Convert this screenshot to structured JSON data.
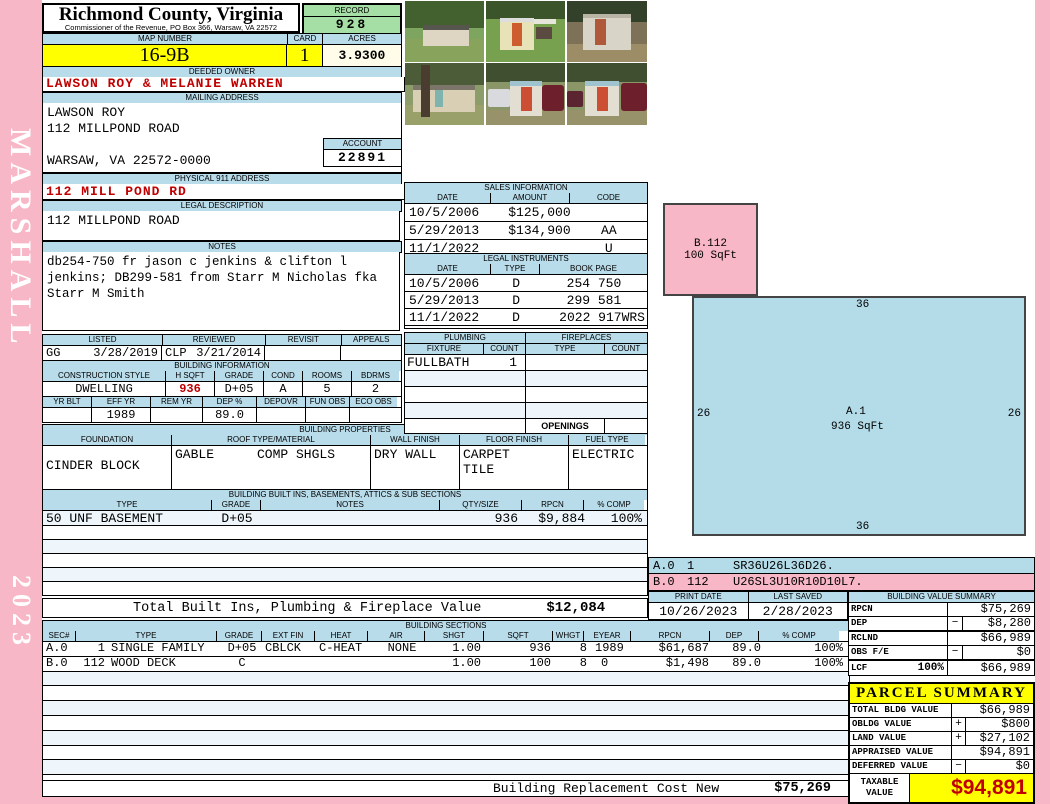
{
  "county": {
    "title": "Richmond County, Virginia",
    "subtitle": "Commissioner of the Revenue, PO Box 366, Warsaw, VA 22572"
  },
  "record": {
    "label": "RECORD",
    "value": "928"
  },
  "map": {
    "label": "MAP NUMBER",
    "value": "16-9B"
  },
  "card": {
    "label": "CARD",
    "value": "1"
  },
  "acres": {
    "label": "ACRES",
    "value": "3.9300"
  },
  "deeded_owner": {
    "label": "DEEDED OWNER",
    "value": "LAWSON ROY & MELANIE WARREN"
  },
  "mailing": {
    "label": "MAILING ADDRESS",
    "line1": "LAWSON ROY",
    "line2": "112 MILLPOND ROAD",
    "line3": "WARSAW, VA 22572-0000"
  },
  "account": {
    "label": "ACCOUNT",
    "value": "22891"
  },
  "physical_address": {
    "label": "PHYSICAL 911 ADDRESS",
    "value": "112 MILL POND RD"
  },
  "legal_description": {
    "label": "LEGAL DESCRIPTION",
    "value": "112 MILLPOND ROAD"
  },
  "notes": {
    "label": "NOTES",
    "text": "db254-750 fr jason c jenkins & clifton l jenkins; DB299-581 from Starr M Nicholas fka Starr M Smith"
  },
  "review": {
    "headers": {
      "listed": "LISTED",
      "reviewed": "REVIEWED",
      "revisit": "REVISIT",
      "appeals": "APPEALS"
    },
    "listed_by": "GG",
    "listed_date": "3/28/2019",
    "reviewed_by": "CLP",
    "reviewed_date": "3/21/2014",
    "revisit": "",
    "appeals": ""
  },
  "building_information": {
    "label": "BUILDING INFORMATION",
    "h1": {
      "style": "CONSTRUCTION STYLE",
      "hsqft": "H SQFT",
      "grade": "GRADE",
      "cond": "COND",
      "rooms": "ROOMS",
      "bdrms": "BDRMS"
    },
    "style": "DWELLING",
    "hsqft": "936",
    "grade": "D+05",
    "cond": "A",
    "rooms": "5",
    "bdrms": "2",
    "h2": {
      "yrblt": "YR BLT",
      "effyr": "EFF YR",
      "remyr": "REM YR",
      "dep": "DEP %",
      "depovr": "DEPOVR",
      "funobs": "FUN OBS",
      "ecoobs": "ECO OBS"
    },
    "yr_blt": "",
    "eff_yr": "1989",
    "rem_yr": "",
    "dep_pct": "89.0",
    "depovr": "",
    "fun_obs": "",
    "eco_obs": ""
  },
  "building_properties": {
    "label": "BUILDING PROPERTIES",
    "h": {
      "foundation": "FOUNDATION",
      "roof": "ROOF TYPE/MATERIAL",
      "wall": "WALL FINISH",
      "floor": "FLOOR FINISH",
      "fuel": "FUEL TYPE"
    },
    "foundation": "CINDER BLOCK",
    "roof_type": "GABLE",
    "roof_material": "COMP SHGLS",
    "wall_finish": "DRY WALL",
    "floor_finish_1": "CARPET",
    "floor_finish_2": "TILE",
    "fuel_type": "ELECTRIC"
  },
  "built_ins": {
    "label": "BUILDING BUILT INS, BASEMENTS, ATTICS & SUB SECTIONS",
    "h": {
      "type": "TYPE",
      "grade": "GRADE",
      "notes": "NOTES",
      "qty": "QTY/SIZE",
      "rpcn": "RPCN",
      "comp": "% COMP"
    },
    "rows": [
      {
        "type": "50 UNF BASEMENT",
        "grade": "D+05",
        "notes": "",
        "qty": "936",
        "rpcn": "$9,884",
        "comp": "100%"
      }
    ],
    "total_label": "Total Built Ins, Plumbing & Fireplace Value",
    "total_value": "$12,084"
  },
  "sales": {
    "label": "SALES INFORMATION",
    "h": {
      "date": "DATE",
      "amount": "AMOUNT",
      "code": "CODE"
    },
    "rows": [
      {
        "date": "10/5/2006",
        "amount": "$125,000",
        "code": ""
      },
      {
        "date": "5/29/2013",
        "amount": "$134,900",
        "code": "AA"
      },
      {
        "date": "11/1/2022",
        "amount": "",
        "code": "U"
      }
    ]
  },
  "legal_instruments": {
    "label": "LEGAL INSTRUMENTS",
    "h": {
      "date": "DATE",
      "type": "TYPE",
      "book": "BOOK PAGE"
    },
    "rows": [
      {
        "date": "10/5/2006",
        "type": "D",
        "book": "254 750"
      },
      {
        "date": "5/29/2013",
        "type": "D",
        "book": "299 581"
      },
      {
        "date": "11/1/2022",
        "type": "D",
        "book": "2022 917WRS"
      }
    ]
  },
  "plumbing": {
    "label": "PLUMBING",
    "h": {
      "fixture": "FIXTURE",
      "count": "COUNT"
    },
    "rows": [
      {
        "fixture": "FULLBATH",
        "count": "1"
      }
    ]
  },
  "fireplaces": {
    "label": "FIREPLACES",
    "h": {
      "type": "TYPE",
      "count": "COUNT"
    },
    "openings_label": "OPENINGS",
    "openings_value": ""
  },
  "sketch": {
    "b_box": {
      "line1": "B.112",
      "line2": "100 SqFt"
    },
    "a_box": {
      "line1": "A.1",
      "line2": "936 SqFt",
      "top": "36",
      "left": "26",
      "right": "26",
      "bottom": "36"
    },
    "legend": [
      {
        "sec": "A.0",
        "num": "1",
        "path": "SR36U26L36D26."
      },
      {
        "sec": "B.0",
        "num": "112",
        "path": "U26SL3U10R10D10L7."
      }
    ]
  },
  "print_info": {
    "print_label": "PRINT DATE",
    "print_date": "10/26/2023",
    "saved_label": "LAST SAVED",
    "saved_date": "2/28/2023"
  },
  "building_value_summary": {
    "label": "BUILDING VALUE SUMMARY",
    "rows": [
      {
        "name": "RPCN",
        "pct": "",
        "op": "",
        "value": "$75,269"
      },
      {
        "name": "DEP",
        "pct": "",
        "op": "−",
        "value": "$8,280"
      },
      {
        "name": "RCLND",
        "pct": "",
        "op": "",
        "value": "$66,989"
      },
      {
        "name": "OBS F/E",
        "pct": "",
        "op": "−",
        "value": "$0"
      },
      {
        "name": "LCF",
        "pct": "100%",
        "op": "",
        "value": "$66,989"
      }
    ]
  },
  "building_sections": {
    "label": "BUILDING SECTIONS",
    "h": {
      "sec": "SEC#",
      "type": "TYPE",
      "grade": "GRADE",
      "ext": "EXT FIN",
      "heat": "HEAT",
      "air": "AIR",
      "shgt": "SHGT",
      "sqft": "SQFT",
      "whgt": "WHGT",
      "eyear": "EYEAR",
      "rpcn": "RPCN",
      "dep": "DEP",
      "comp": "% COMP"
    },
    "rows": [
      {
        "sec": "A.0",
        "num": "1",
        "type": "SINGLE FAMILY",
        "grade": "D+05",
        "ext": "CBLCK",
        "heat": "C-HEAT",
        "air": "NONE",
        "shgt": "1.00",
        "sqft": "936",
        "whgt": "8",
        "eyear": "1989",
        "rpcn": "$61,687",
        "dep": "89.0",
        "comp": "100%"
      },
      {
        "sec": "B.0",
        "num": "112",
        "type": "WOOD DECK",
        "grade": "C",
        "ext": "",
        "heat": "",
        "air": "",
        "shgt": "1.00",
        "sqft": "100",
        "whgt": "8",
        "eyear": "0",
        "rpcn": "$1,498",
        "dep": "89.0",
        "comp": "100%"
      }
    ]
  },
  "replacement": {
    "label": "Building Replacement Cost New",
    "value": "$75,269"
  },
  "parcel_summary": {
    "label": "PARCEL SUMMARY",
    "rows": [
      {
        "name": "TOTAL BLDG VALUE",
        "op": "",
        "value": "$66,989"
      },
      {
        "name": "OBLDG VALUE",
        "op": "+",
        "value": "$800"
      },
      {
        "name": "LAND VALUE",
        "op": "+",
        "value": "$27,102"
      },
      {
        "name": "APPRAISED VALUE",
        "op": "",
        "value": "$94,891"
      },
      {
        "name": "DEFERRED VALUE",
        "op": "−",
        "value": "$0"
      }
    ],
    "taxable_label": "TAXABLE VALUE",
    "taxable_value": "$94,891"
  },
  "sidebar": {
    "name": "MARSHALL",
    "year": "2023"
  },
  "colors": {
    "accent_blue": "#b9dcea",
    "accent_green": "#a5dfa5",
    "accent_yellow": "#ffff00",
    "accent_pink": "#f8b7c6",
    "value_red": "#c00000"
  }
}
